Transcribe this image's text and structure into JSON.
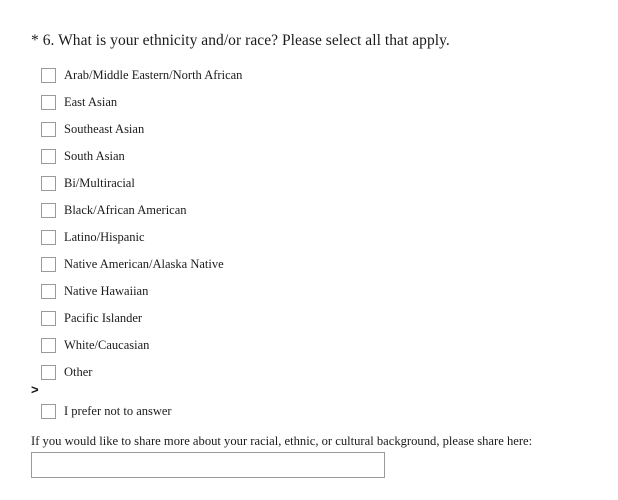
{
  "question": {
    "required_marker": "*",
    "number": "6.",
    "text": "What is your ethnicity and/or race? Please select all that apply.",
    "full_title": "* 6. What is your ethnicity and/or race? Please select all that apply."
  },
  "options": [
    {
      "label": "Arab/Middle Eastern/North African",
      "checked": false
    },
    {
      "label": "East Asian",
      "checked": false
    },
    {
      "label": "Southeast Asian",
      "checked": false
    },
    {
      "label": "South Asian",
      "checked": false
    },
    {
      "label": "Bi/Multiracial",
      "checked": false
    },
    {
      "label": "Black/African American",
      "checked": false
    },
    {
      "label": "Latino/Hispanic",
      "checked": false
    },
    {
      "label": "Native American/Alaska Native",
      "checked": false
    },
    {
      "label": "Native Hawaiian",
      "checked": false
    },
    {
      "label": "Pacific Islander",
      "checked": false
    },
    {
      "label": "White/Caucasian",
      "checked": false
    },
    {
      "label": "Other",
      "checked": false
    }
  ],
  "separator": {
    "glyph": ">"
  },
  "opt_out": {
    "label": "I prefer not to answer",
    "checked": false
  },
  "followup": {
    "prompt": "If you would like to share more about your racial, ethnic, or cultural background, please share here:",
    "value": "",
    "placeholder": ""
  },
  "colors": {
    "background": "#ffffff",
    "text": "#1b1b1b",
    "border": "#9a9a9a"
  }
}
